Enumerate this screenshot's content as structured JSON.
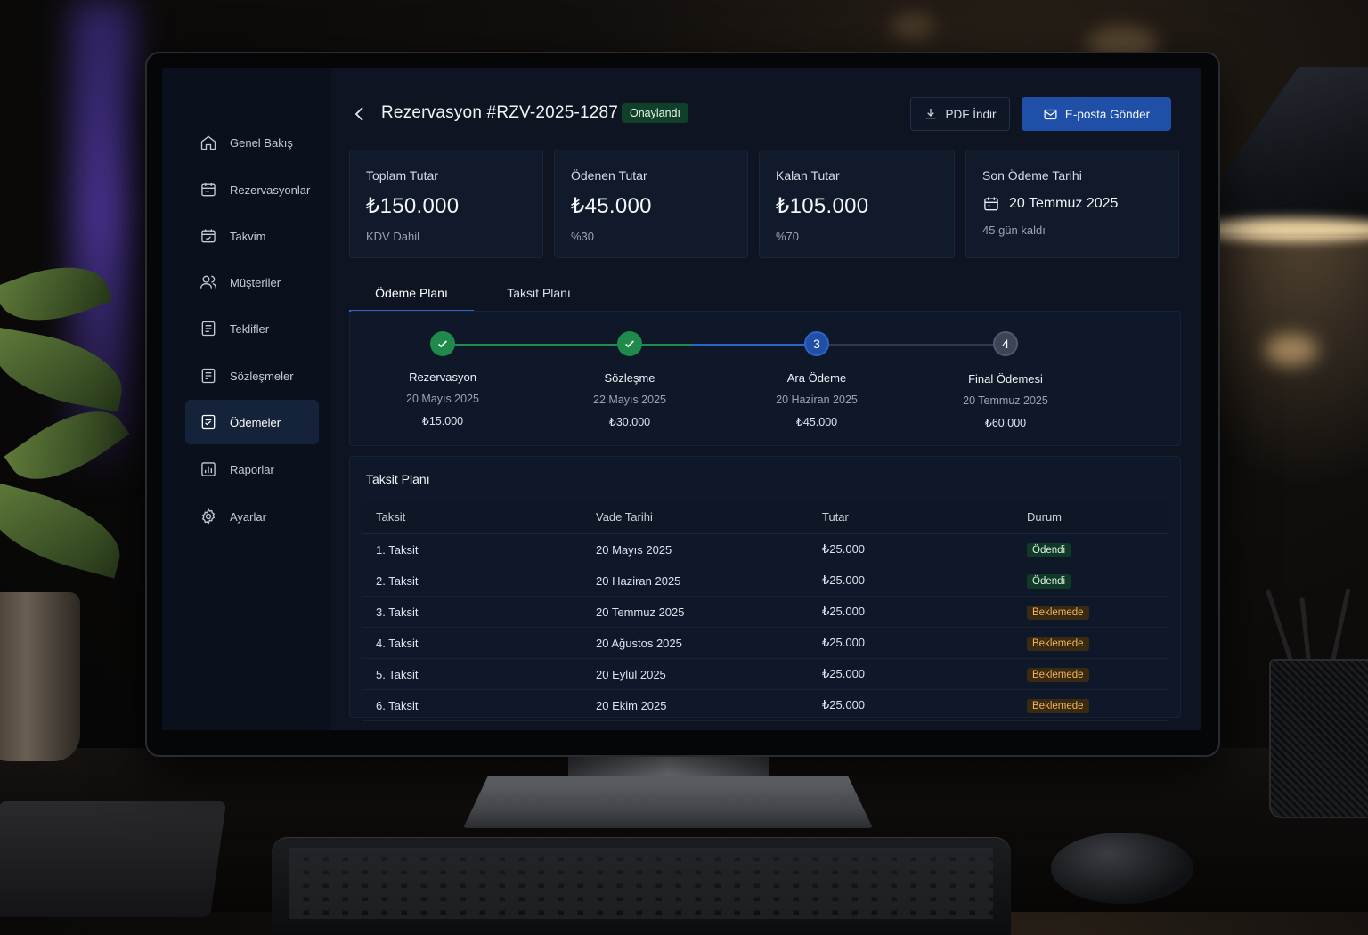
{
  "window": {
    "title": "Rezervasyon #RZV-2025-1287",
    "status": "Onaylandı"
  },
  "header": {
    "pdf_label": "PDF İndir",
    "email_label": "E-posta Gönder"
  },
  "sidebar": {
    "items": [
      {
        "label": "Genel Bakış",
        "icon": "home-icon"
      },
      {
        "label": "Rezervasyonlar",
        "icon": "calendar-icon"
      },
      {
        "label": "Takvim",
        "icon": "calendar-icon"
      },
      {
        "label": "Müşteriler",
        "icon": "users-icon"
      },
      {
        "label": "Teklifler",
        "icon": "document-icon"
      },
      {
        "label": "Sözleşmeler",
        "icon": "document-icon"
      },
      {
        "label": "Ödemeler",
        "icon": "payment-icon",
        "active": true
      },
      {
        "label": "Raporlar",
        "icon": "chart-icon"
      },
      {
        "label": "Ayarlar",
        "icon": "gear-icon"
      }
    ]
  },
  "stats": [
    {
      "label": "Toplam Tutar",
      "value": "₺150.000",
      "sub": "KDV Dahil"
    },
    {
      "label": "Ödenen Tutar",
      "value": "₺45.000",
      "sub": "%30"
    },
    {
      "label": "Kalan Tutar",
      "value": "₺105.000",
      "sub": "%70"
    },
    {
      "label": "Son Ödeme Tarihi",
      "value": "20 Temmuz 2025",
      "sub": "45 gün kaldı"
    }
  ],
  "tabs": [
    {
      "label": "Ödeme Planı",
      "active": true
    },
    {
      "label": "Taksit Planı",
      "active": false
    }
  ],
  "steps": [
    {
      "number": "1",
      "title": "Rezervasyon",
      "date": "20 Mayıs 2025",
      "amount": "₺15.000",
      "state": "done"
    },
    {
      "number": "2",
      "title": "Sözleşme",
      "date": "22 Mayıs 2025",
      "amount": "₺30.000",
      "state": "done"
    },
    {
      "number": "3",
      "title": "Ara Ödeme",
      "date": "20 Haziran 2025",
      "amount": "₺45.000",
      "state": "current"
    },
    {
      "number": "4",
      "title": "Final Ödemesi",
      "date": "20 Temmuz 2025",
      "amount": "₺60.000",
      "state": "upcoming"
    }
  ],
  "installments": {
    "title": "Taksit Planı",
    "columns": [
      "Taksit",
      "Vade Tarihi",
      "Tutar",
      "Durum"
    ],
    "rows": [
      {
        "name": "1. Taksit",
        "due": "20 Mayıs 2025",
        "amount": "₺25.000",
        "status": "Ödendi",
        "state": "paid"
      },
      {
        "name": "2. Taksit",
        "due": "20 Haziran 2025",
        "amount": "₺25.000",
        "status": "Ödendi",
        "state": "paid"
      },
      {
        "name": "3. Taksit",
        "due": "20 Temmuz 2025",
        "amount": "₺25.000",
        "status": "Beklemede",
        "state": "pending"
      },
      {
        "name": "4. Taksit",
        "due": "20 Ağustos 2025",
        "amount": "₺25.000",
        "status": "Beklemede",
        "state": "pending"
      },
      {
        "name": "5. Taksit",
        "due": "20 Eylül 2025",
        "amount": "₺25.000",
        "status": "Beklemede",
        "state": "pending"
      },
      {
        "name": "6. Taksit",
        "due": "20 Ekim 2025",
        "amount": "₺25.000",
        "status": "Beklemede",
        "state": "pending"
      }
    ]
  },
  "colors": {
    "accent": "#1f4fa6",
    "success": "#1e8a4c",
    "pending": "#f0b55a",
    "background": "#0e1422"
  }
}
